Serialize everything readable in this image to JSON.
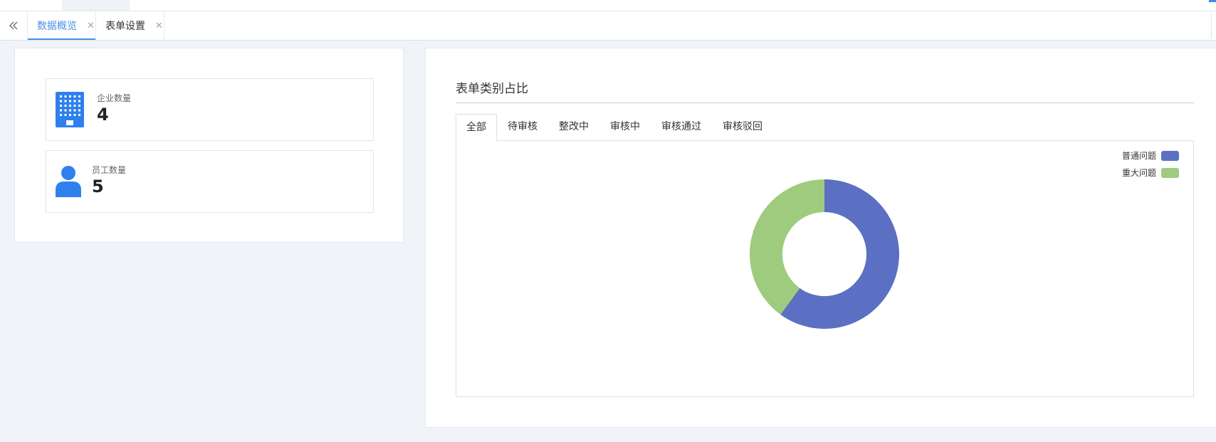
{
  "tabs": {
    "items": [
      {
        "label": "数据概览",
        "active": true
      },
      {
        "label": "表单设置",
        "active": false
      }
    ]
  },
  "stats": {
    "company": {
      "label": "企业数量",
      "value": "4"
    },
    "employee": {
      "label": "员工数量",
      "value": "5"
    }
  },
  "chart_section": {
    "title": "表单类别占比",
    "filter_tabs": [
      "全部",
      "待审核",
      "整改中",
      "审核中",
      "审核通过",
      "审核驳回"
    ],
    "active_filter": "全部"
  },
  "colors": {
    "accent": "#4a90e2",
    "icon_blue": "#2f80ed",
    "series_blue": "#5b70c2",
    "series_green": "#9ecb7e"
  },
  "chart_data": {
    "type": "pie",
    "variant": "donut",
    "legend_position": "top-right",
    "series": [
      {
        "name": "普通问题",
        "value": 3,
        "color": "#5b70c2"
      },
      {
        "name": "重大问题",
        "value": 2,
        "color": "#9ecb7e"
      }
    ]
  }
}
